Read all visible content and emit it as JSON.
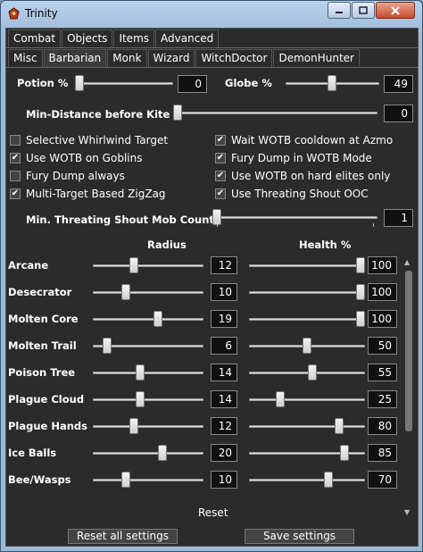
{
  "window": {
    "title": "Trinity"
  },
  "tabs_primary": [
    "Combat",
    "Objects",
    "Items",
    "Advanced"
  ],
  "tabs_secondary": [
    "Misc",
    "Barbarian",
    "Monk",
    "Wizard",
    "WitchDoctor",
    "DemonHunter"
  ],
  "potion": {
    "label": "Potion %",
    "value": "0",
    "fraction": 0.0
  },
  "globe": {
    "label": "Globe %",
    "value": "49",
    "fraction": 0.49
  },
  "min_distance": {
    "label": "Min-Distance before Kite",
    "value": "0",
    "fraction": 0.0
  },
  "checks": [
    {
      "label": "Selective Whirlwind Target",
      "checked": false
    },
    {
      "label": "Use WOTB on Goblins",
      "checked": true
    },
    {
      "label": "Fury Dump always",
      "checked": false
    },
    {
      "label": "Multi-Target Based ZigZag",
      "checked": true
    },
    {
      "label": "Wait WOTB cooldown at Azmo",
      "checked": true
    },
    {
      "label": "Fury Dump in WOTB Mode",
      "checked": true
    },
    {
      "label": "Use WOTB on hard elites only",
      "checked": true
    },
    {
      "label": "Use Threating Shout OOC",
      "checked": true
    }
  ],
  "shout_count": {
    "label": "Min. Threating Shout Mob Count",
    "value": "1",
    "fraction": 0.0
  },
  "headers": {
    "radius": "Radius",
    "health": "Health %"
  },
  "avoidance": [
    {
      "name": "Arcane",
      "radius": "12",
      "r_frac": 0.36,
      "health": "100",
      "h_frac": 1.0
    },
    {
      "name": "Desecrator",
      "radius": "10",
      "r_frac": 0.28,
      "health": "100",
      "h_frac": 1.0
    },
    {
      "name": "Molten Core",
      "radius": "19",
      "r_frac": 0.6,
      "health": "100",
      "h_frac": 1.0
    },
    {
      "name": "Molten Trail",
      "radius": "6",
      "r_frac": 0.1,
      "health": "50",
      "h_frac": 0.5
    },
    {
      "name": "Poison Tree",
      "radius": "14",
      "r_frac": 0.42,
      "health": "55",
      "h_frac": 0.55
    },
    {
      "name": "Plague Cloud",
      "radius": "14",
      "r_frac": 0.42,
      "health": "25",
      "h_frac": 0.25
    },
    {
      "name": "Plague Hands",
      "radius": "12",
      "r_frac": 0.36,
      "health": "80",
      "h_frac": 0.8
    },
    {
      "name": "Ice Balls",
      "radius": "20",
      "r_frac": 0.64,
      "health": "85",
      "h_frac": 0.85
    },
    {
      "name": "Bee/Wasps",
      "radius": "10",
      "r_frac": 0.28,
      "health": "70",
      "h_frac": 0.7
    }
  ],
  "buttons": {
    "reset": "Reset",
    "reset_all": "Reset all settings",
    "save": "Save settings"
  }
}
